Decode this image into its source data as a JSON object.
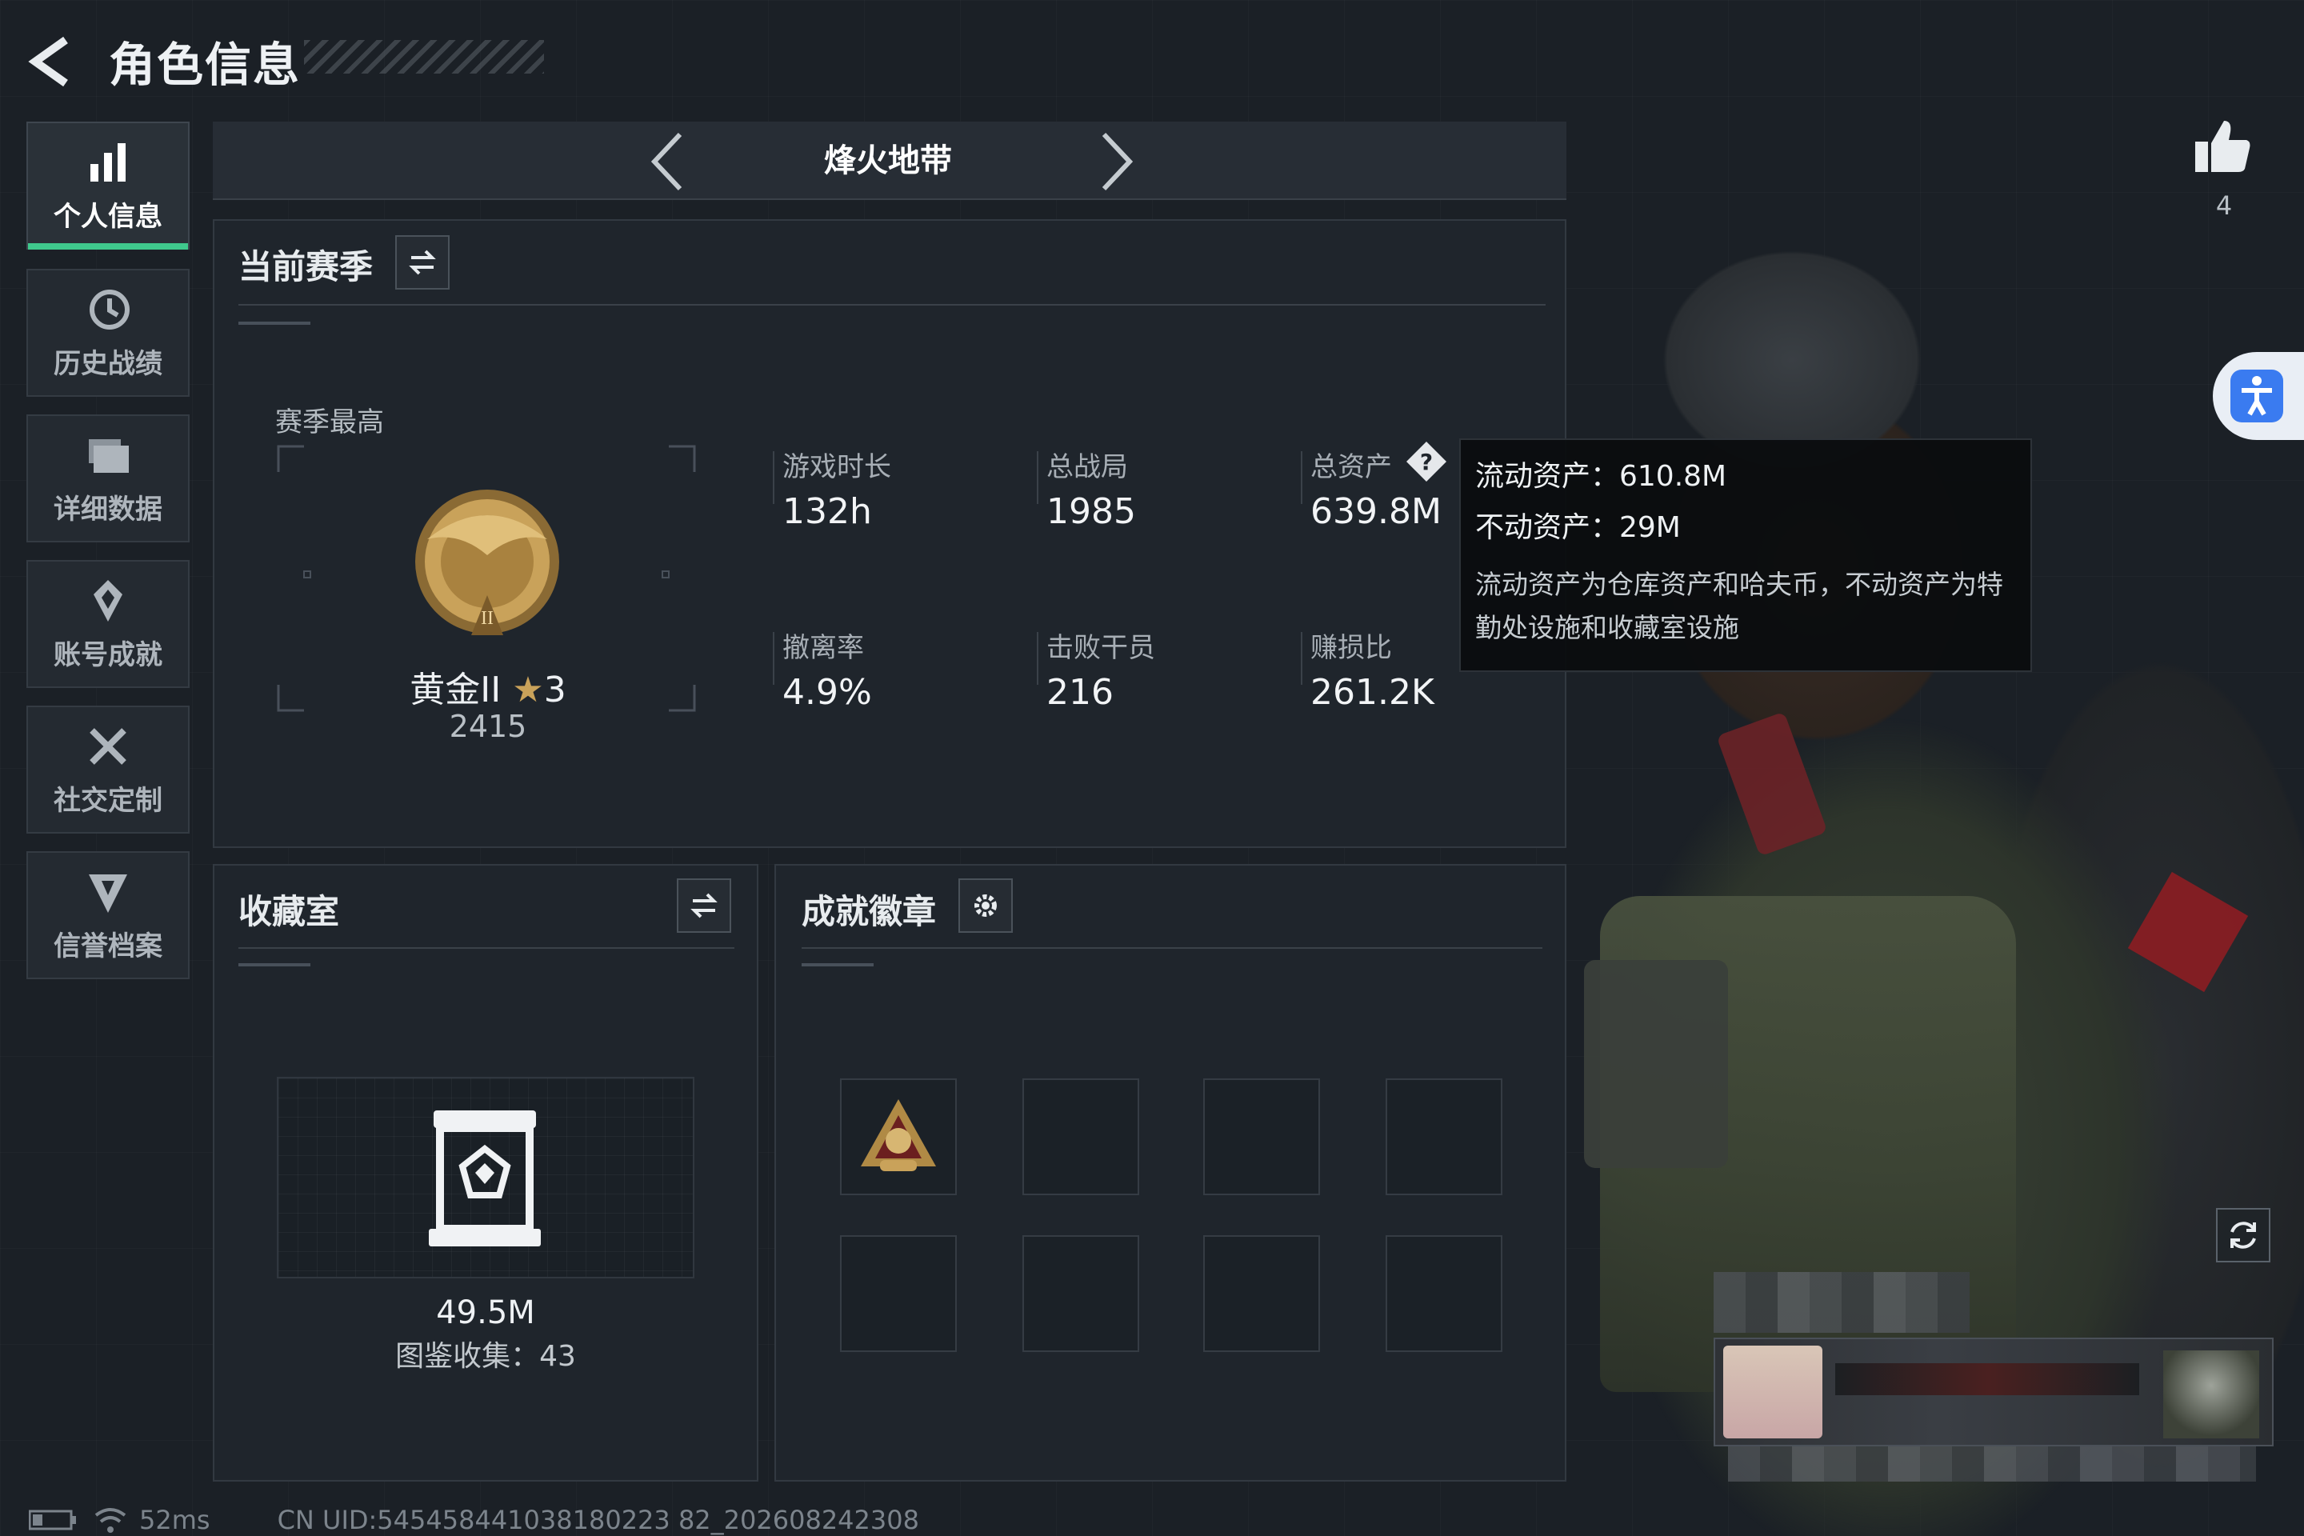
{
  "header": {
    "title": "角色信息"
  },
  "sidebar": {
    "items": [
      {
        "label": "个人信息",
        "icon": "bar-chart-icon",
        "active": true
      },
      {
        "label": "历史战绩",
        "icon": "history-clock-icon",
        "active": false
      },
      {
        "label": "详细数据",
        "icon": "folder-icon",
        "active": false
      },
      {
        "label": "账号成就",
        "icon": "achievement-icon",
        "active": false
      },
      {
        "label": "社交定制",
        "icon": "tools-icon",
        "active": false
      },
      {
        "label": "信誉档案",
        "icon": "shield-icon",
        "active": false
      }
    ]
  },
  "mode": {
    "name": "烽火地带"
  },
  "season": {
    "title": "当前赛季",
    "best_label": "赛季最高",
    "rank_name": "黄金II",
    "rank_stars": "3",
    "rank_score": "2415",
    "stats": [
      {
        "label": "游戏时长",
        "value": "132h"
      },
      {
        "label": "总战局",
        "value": "1985"
      },
      {
        "label": "总资产",
        "value": "639.8M"
      },
      {
        "label": "撤离率",
        "value": "4.9%"
      },
      {
        "label": "击败干员",
        "value": "216"
      },
      {
        "label": "赚损比",
        "value": "261.2K"
      }
    ]
  },
  "tooltip": {
    "liquid": "流动资产：610.8M",
    "fixed": "不动资产：29M",
    "description": "流动资产为仓库资产和哈夫币，不动资产为特勤处设施和收藏室设施"
  },
  "collection": {
    "title": "收藏室",
    "value": "49.5M",
    "catalog": "图鉴收集：43"
  },
  "badges": {
    "title": "成就徽章"
  },
  "likes": {
    "count": "4"
  },
  "status": {
    "ping": "52ms",
    "uid": "CN UID:545458441038180223 82_202608242308"
  },
  "colors": {
    "background": "#1b2026",
    "panel": "#1f252c",
    "accent_green": "#3fc98d",
    "gold": "#c9a25a",
    "access_blue": "#3a7bf0"
  }
}
